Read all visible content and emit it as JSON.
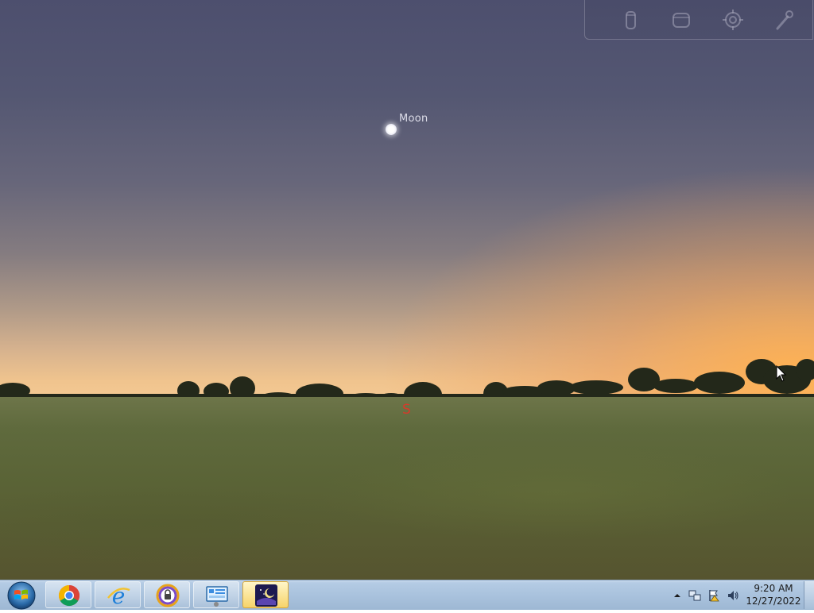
{
  "sky": {
    "objects": [
      {
        "name": "Moon"
      }
    ],
    "cardinal": "S"
  },
  "toolbar": {
    "buttons": [
      {
        "icon": "telescope-icon"
      },
      {
        "icon": "ocular-icon"
      },
      {
        "icon": "crosshair-icon"
      },
      {
        "icon": "wrench-icon"
      }
    ]
  },
  "taskbar": {
    "apps": [
      {
        "icon": "chrome-icon"
      },
      {
        "icon": "internet-explorer-icon"
      },
      {
        "icon": "vpn-lock-icon"
      },
      {
        "icon": "control-panel-icon"
      },
      {
        "icon": "stellarium-icon",
        "active": true
      }
    ],
    "clock": {
      "time": "9:20 AM",
      "date": "12/27/2022"
    }
  },
  "colors": {
    "cardinal_red": "#d8392a",
    "moon_label": "#dcdce8",
    "active_taskbar": "#f6d36a"
  }
}
